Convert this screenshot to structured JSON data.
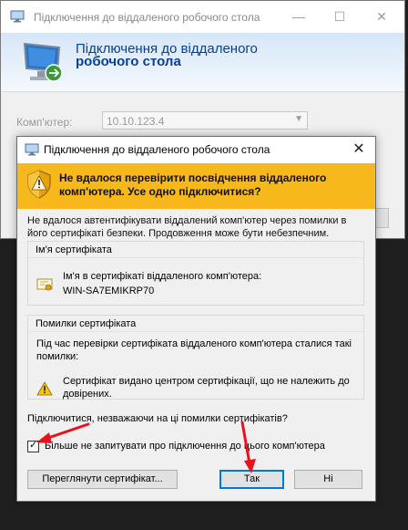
{
  "background_window": {
    "title": "Підключення до віддаленого робочого стола",
    "header_line1": "Підключення до віддаленого",
    "header_line2": "робочого стола",
    "computer_label": "Комп'ютер:",
    "computer_value": "10.10.123.4",
    "icons": {
      "title": "remote-desktop-icon",
      "header": "monitor-network-icon",
      "minimize": "minimize-icon",
      "maximize": "maximize-icon",
      "close": "close-icon",
      "dropdown": "chevron-down-icon"
    }
  },
  "dialog": {
    "title": "Підключення до віддаленого робочого стола",
    "warning_text": "Не вдалося перевірити посвідчення віддаленого комп'ютера. Усе одно підключитися?",
    "description": "Не вдалося автентифікувати віддалений комп'ютер через помилки в його сертифікаті безпеки. Продовження може бути небезпечним.",
    "cert_group": {
      "title": "Ім'я сертифіката",
      "label": "Ім'я в сертифікаті віддаленого комп'ютера:",
      "value": "WIN-SA7EMIKRP70"
    },
    "errors_group": {
      "title": "Помилки сертифіката",
      "intro": "Під час перевірки сертифіката віддаленого комп'ютера сталися такі помилки:",
      "item": "Сертифікат видано центром сертифікації, що не належить до довірених."
    },
    "question": "Підключитися, незважаючи на ці помилки сертифікатів?",
    "checkbox": {
      "label": "Більше не запитувати про підключення до цього комп'ютера",
      "checked": true,
      "mark": "✓"
    },
    "buttons": {
      "view_cert": "Переглянути сертифікат...",
      "yes": "Так",
      "no": "Ні"
    },
    "icons": {
      "title": "remote-desktop-icon",
      "close": "close-icon",
      "banner": "warning-shield-icon",
      "certificate": "certificate-icon",
      "error": "warning-triangle-icon"
    }
  },
  "colors": {
    "banner": "#f6b81b",
    "header_text": "#0a3f96",
    "annotation_arrow": "#e8121b",
    "default_button_border": "#0078d7"
  }
}
